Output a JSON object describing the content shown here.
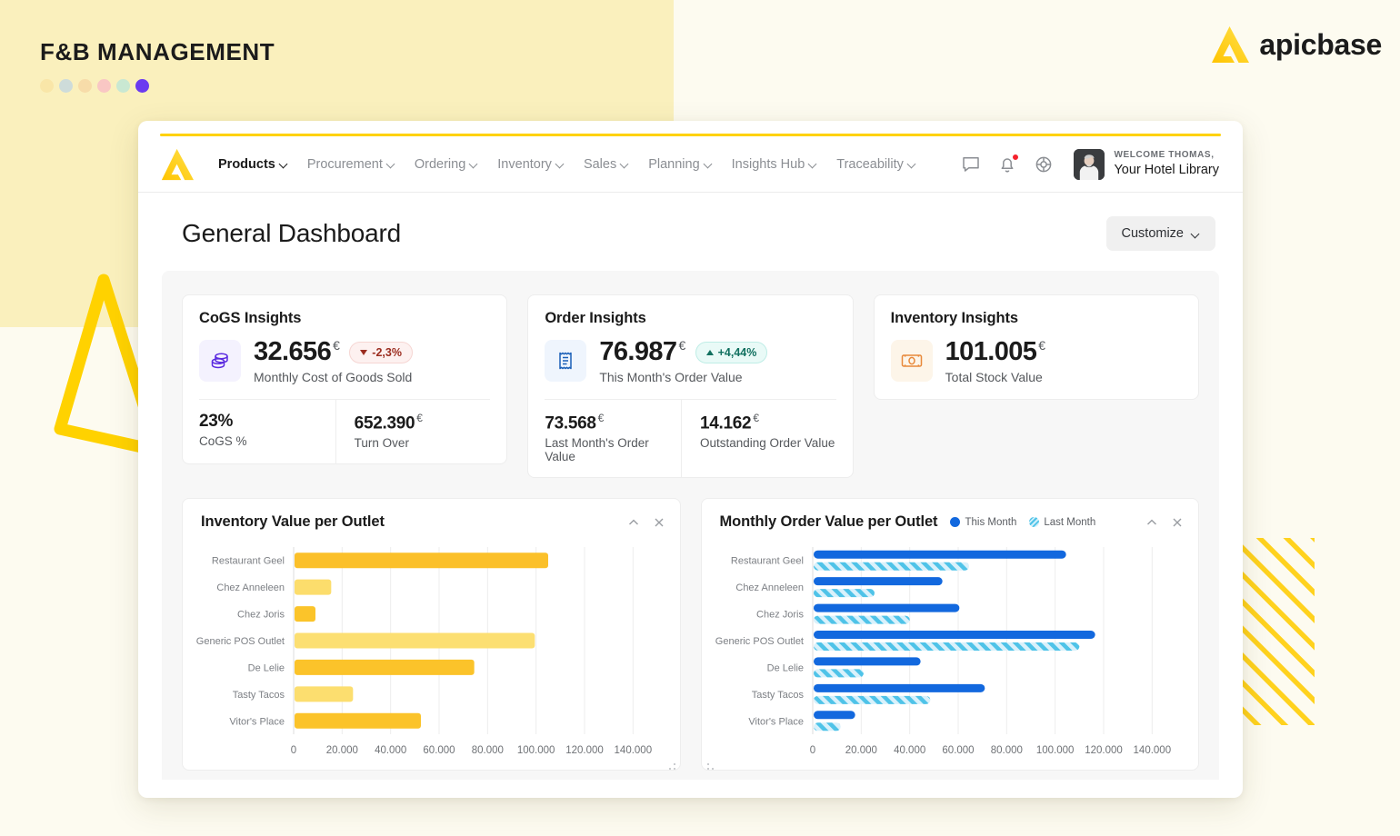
{
  "page_header": {
    "title": "F&B MANAGEMENT",
    "dots": [
      "#F9E6A8",
      "#CEDCDA",
      "#F7DCA9",
      "#F9C7C4",
      "#C9E8D2",
      "#6B3BF0"
    ],
    "brand_name": "apicbase",
    "brand_icon": "apicbase-a-logo"
  },
  "topnav": {
    "logo_icon": "apicbase-a-logo",
    "items": [
      {
        "label": "Products",
        "active": true,
        "caret": "chevron-down-icon"
      },
      {
        "label": "Procurement",
        "active": false,
        "caret": "chevron-down-icon"
      },
      {
        "label": "Ordering",
        "active": false,
        "caret": "chevron-down-icon"
      },
      {
        "label": "Inventory",
        "active": false,
        "caret": "chevron-down-icon"
      },
      {
        "label": "Sales",
        "active": false,
        "caret": "chevron-down-icon"
      },
      {
        "label": "Planning",
        "active": false,
        "caret": "chevron-down-icon"
      },
      {
        "label": "Insights Hub",
        "active": false,
        "caret": "chevron-down-icon"
      },
      {
        "label": "Traceability",
        "active": false,
        "caret": "chevron-down-icon"
      }
    ],
    "icons": [
      {
        "name": "chat-icon"
      },
      {
        "name": "notification-bell-icon",
        "has_badge": true
      },
      {
        "name": "lifebuoy-help-icon"
      }
    ],
    "user": {
      "welcome": "WELCOME THOMAS,",
      "account": "Your Hotel Library",
      "avatar": "user-avatar"
    }
  },
  "title_row": {
    "page_title": "General Dashboard",
    "customize_label": "Customize",
    "customize_caret": "chevron-down-icon"
  },
  "kpi_cards": [
    {
      "title": "CoGS Insights",
      "icon": "coins-stack-icon",
      "icon_color": "#5B2BE0",
      "icon_bg": "#F4F2FE",
      "value": "32.656",
      "currency": "€",
      "subtitle": "Monthly Cost of Goods Sold",
      "delta": {
        "text": "-2,3%",
        "direction": "down"
      },
      "footer": [
        {
          "value": "23%",
          "currency": "",
          "label": "CoGS %"
        },
        {
          "value": "652.390",
          "currency": "€",
          "label": "Turn Over"
        }
      ]
    },
    {
      "title": "Order Insights",
      "icon": "receipt-icon",
      "icon_color": "#1B60B8",
      "icon_bg": "#EFF5FD",
      "value": "76.987",
      "currency": "€",
      "subtitle": "This Month's Order Value",
      "delta": {
        "text": "+4,44%",
        "direction": "up"
      },
      "footer": [
        {
          "value": "73.568",
          "currency": "€",
          "label": "Last Month's Order Value"
        },
        {
          "value": "14.162",
          "currency": "€",
          "label": "Outstanding Order Value"
        }
      ]
    },
    {
      "title": "Inventory Insights",
      "icon": "banknote-icon",
      "icon_color": "#E8893B",
      "icon_bg": "#FDF5E9",
      "value": "101.005",
      "currency": "€",
      "subtitle": "Total Stock Value",
      "delta": null,
      "footer": []
    }
  ],
  "charts": {
    "collapse_icon": "chevron-up-icon",
    "close_icon": "close-icon",
    "resize_icon": "resize-handle-icon"
  },
  "chart_data": [
    {
      "type": "bar",
      "orientation": "horizontal",
      "title": "Inventory Value per Outlet",
      "categories": [
        "Restaurant Geel",
        "Chez Anneleen",
        "Chez Joris",
        "Generic POS Outlet",
        "De Lelie",
        "Tasty Tacos",
        "Vitor's Place"
      ],
      "series": [
        {
          "name": "Inventory Value",
          "values": [
            105000,
            15500,
            9000,
            99500,
            74500,
            24500,
            52500
          ]
        }
      ],
      "bar_colors": [
        "#FBC02A",
        "#FCDD6C",
        "#FBC42A",
        "#FCDF72",
        "#FBC32A",
        "#FCDE6F",
        "#FBC32A"
      ],
      "xlabel": "",
      "ylabel": "",
      "xlim": [
        0,
        150000
      ],
      "xticks": [
        "0",
        "20.000",
        "40.000",
        "60.000",
        "80.000",
        "100.000",
        "120.000",
        "140.000"
      ],
      "xtick_values": [
        0,
        20000,
        40000,
        60000,
        80000,
        100000,
        120000,
        140000
      ],
      "grid": true,
      "legend": null
    },
    {
      "type": "bar",
      "orientation": "horizontal",
      "title": "Monthly Order Value per Outlet",
      "categories": [
        "Restaurant Geel",
        "Chez Anneleen",
        "Chez Joris",
        "Generic POS Outlet",
        "De Lelie",
        "Tasty Tacos",
        "Vitor's Place"
      ],
      "series": [
        {
          "name": "This Month",
          "values": [
            104500,
            53500,
            60500,
            116500,
            44500,
            71000,
            17500
          ],
          "color": "#1268DE",
          "style": "solid"
        },
        {
          "name": "Last Month",
          "values": [
            64500,
            25500,
            40000,
            110000,
            21000,
            48500,
            11500
          ],
          "color": "#4FC3E8",
          "style": "hatched"
        }
      ],
      "xlabel": "",
      "ylabel": "",
      "xlim": [
        0,
        150000
      ],
      "xticks": [
        "0",
        "20.000",
        "40.000",
        "60.000",
        "80.000",
        "100.000",
        "120.000",
        "140.000"
      ],
      "xtick_values": [
        0,
        20000,
        40000,
        60000,
        80000,
        100000,
        120000,
        140000
      ],
      "grid": true,
      "legend": {
        "position": "top",
        "entries": [
          "This Month",
          "Last Month"
        ]
      }
    }
  ]
}
